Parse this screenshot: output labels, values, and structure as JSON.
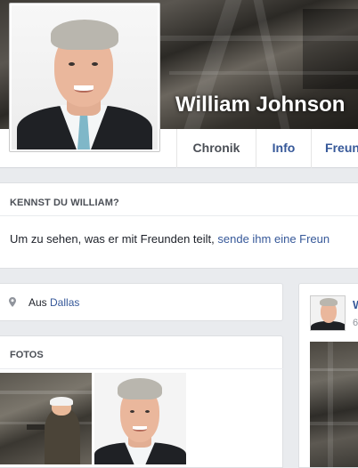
{
  "profile": {
    "name": "William Johnson"
  },
  "nav": {
    "tabs": [
      {
        "label": "Chronik"
      },
      {
        "label": "Info"
      },
      {
        "label": "Freun"
      }
    ]
  },
  "know_card": {
    "title": "KENNST DU WILLIAM?",
    "text_prefix": "Um zu sehen, was er mit Freunden teilt, ",
    "text_link": "sende ihm eine Freun"
  },
  "about": {
    "prefix": "Aus ",
    "city": "Dallas",
    "icon": "location-pin-icon"
  },
  "photos": {
    "title": "FOTOS"
  },
  "post": {
    "name_partial": "W",
    "time_partial": "6"
  },
  "colors": {
    "link": "#365899",
    "page_bg": "#e9ebee",
    "card_bg": "#ffffff"
  }
}
